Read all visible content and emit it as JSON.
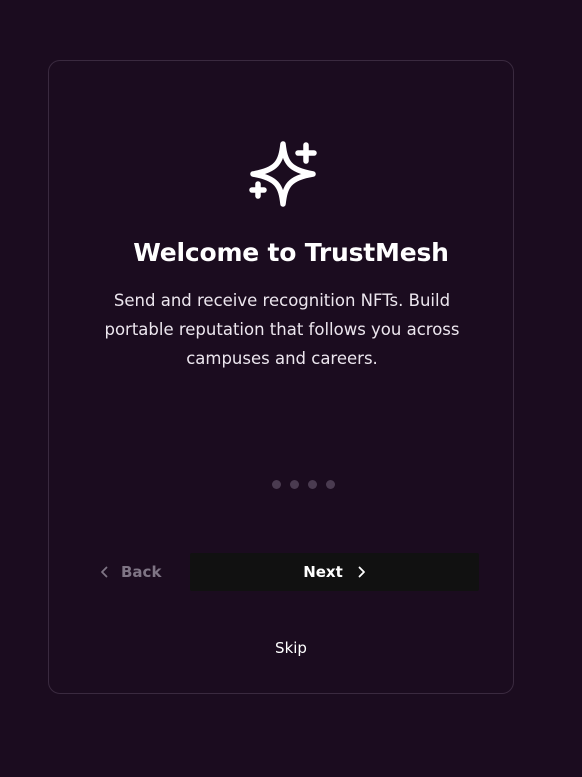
{
  "onboarding": {
    "title": "Welcome to TrustMesh",
    "description": "Send and receive recognition NFTs. Build portable reputation that follows you across campuses and careers.",
    "step_count": 4,
    "icon": "sparkles-icon"
  },
  "navigation": {
    "back_label": "Back",
    "next_label": "Next",
    "skip_label": "Skip"
  },
  "colors": {
    "background": "#1b0c1f",
    "card_border": "#3a2a3f",
    "next_button_bg": "#111111",
    "muted_text": "#7f7585",
    "dot_inactive": "#4a3b50"
  }
}
